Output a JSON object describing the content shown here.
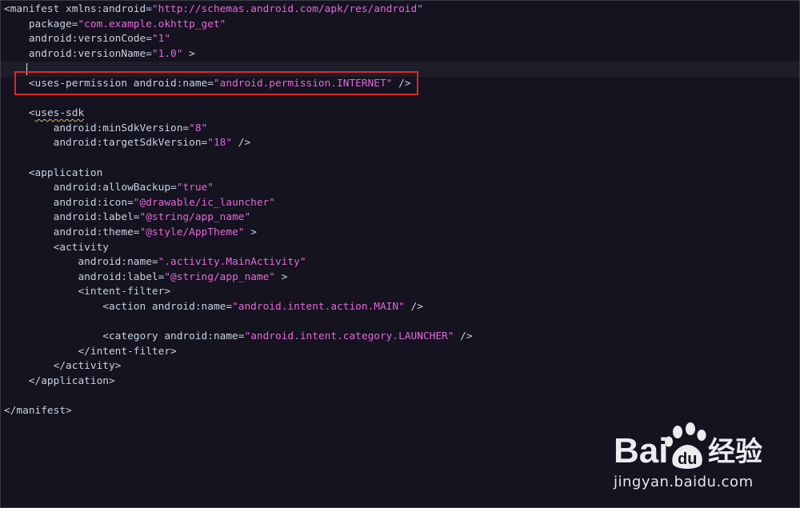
{
  "colors": {
    "background": "#14131f",
    "text": "#c8d2e0",
    "string": "#e468d8",
    "highlight_box": "#e0262a",
    "current_line": "#1e1e2b"
  },
  "editor": {
    "lines": [
      {
        "tokens": [
          {
            "t": "tag",
            "v": "<manifest xmlns:android="
          },
          {
            "t": "str",
            "v": "\"http://schemas.android.com/apk/res/android\""
          }
        ]
      },
      {
        "tokens": [
          {
            "t": "attr",
            "v": "    package="
          },
          {
            "t": "str",
            "v": "\"com.example.okhttp_get\""
          }
        ]
      },
      {
        "tokens": [
          {
            "t": "attr",
            "v": "    android:versionCode="
          },
          {
            "t": "str",
            "v": "\"1\""
          }
        ]
      },
      {
        "tokens": [
          {
            "t": "attr",
            "v": "    android:versionName="
          },
          {
            "t": "str",
            "v": "\"1.0\""
          },
          {
            "t": "punct",
            "v": " >"
          }
        ]
      },
      {
        "tokens": [],
        "current": true
      },
      {
        "tokens": [
          {
            "t": "tag",
            "v": "    <uses-permission android:name="
          },
          {
            "t": "str",
            "v": "\"android.permission.INTERNET\""
          },
          {
            "t": "punct",
            "v": " />"
          }
        ]
      },
      {
        "tokens": []
      },
      {
        "tokens": [
          {
            "t": "tag",
            "v": "    <"
          },
          {
            "t": "tag",
            "v": "uses-sdk",
            "squiggle": true
          }
        ]
      },
      {
        "tokens": [
          {
            "t": "attr",
            "v": "        android:minSdkVersion="
          },
          {
            "t": "str",
            "v": "\"8\""
          }
        ]
      },
      {
        "tokens": [
          {
            "t": "attr",
            "v": "        android:targetSdkVersion="
          },
          {
            "t": "str",
            "v": "\"18\""
          },
          {
            "t": "punct",
            "v": " />"
          }
        ]
      },
      {
        "tokens": []
      },
      {
        "tokens": [
          {
            "t": "tag",
            "v": "    <application"
          }
        ]
      },
      {
        "tokens": [
          {
            "t": "attr",
            "v": "        android:allowBackup="
          },
          {
            "t": "str",
            "v": "\"true\""
          }
        ]
      },
      {
        "tokens": [
          {
            "t": "attr",
            "v": "        android:icon="
          },
          {
            "t": "str",
            "v": "\"@drawable/ic_launcher\""
          }
        ]
      },
      {
        "tokens": [
          {
            "t": "attr",
            "v": "        android:label="
          },
          {
            "t": "str",
            "v": "\"@string/app_name\""
          }
        ]
      },
      {
        "tokens": [
          {
            "t": "attr",
            "v": "        android:theme="
          },
          {
            "t": "str",
            "v": "\"@style/AppTheme\""
          },
          {
            "t": "punct",
            "v": " >"
          }
        ]
      },
      {
        "tokens": [
          {
            "t": "tag",
            "v": "        <activity"
          }
        ]
      },
      {
        "tokens": [
          {
            "t": "attr",
            "v": "            android:name="
          },
          {
            "t": "str",
            "v": "\".activity.MainActivity\""
          }
        ]
      },
      {
        "tokens": [
          {
            "t": "attr",
            "v": "            android:label="
          },
          {
            "t": "str",
            "v": "\"@string/app_name\""
          },
          {
            "t": "punct",
            "v": " >"
          }
        ]
      },
      {
        "tokens": [
          {
            "t": "tag",
            "v": "            <intent-filter>"
          }
        ]
      },
      {
        "tokens": [
          {
            "t": "tag",
            "v": "                <action android:name="
          },
          {
            "t": "str",
            "v": "\"android.intent.action.MAIN\""
          },
          {
            "t": "punct",
            "v": " />"
          }
        ]
      },
      {
        "tokens": []
      },
      {
        "tokens": [
          {
            "t": "tag",
            "v": "                <category android:name="
          },
          {
            "t": "str",
            "v": "\"android.intent.category.LAUNCHER\""
          },
          {
            "t": "punct",
            "v": " />"
          }
        ]
      },
      {
        "tokens": [
          {
            "t": "tag",
            "v": "            </intent-filter>"
          }
        ]
      },
      {
        "tokens": [
          {
            "t": "tag",
            "v": "        </activity>"
          }
        ]
      },
      {
        "tokens": [
          {
            "t": "tag",
            "v": "    </application>"
          }
        ]
      },
      {
        "tokens": []
      },
      {
        "tokens": [
          {
            "t": "tag",
            "v": "</manifest>"
          }
        ]
      }
    ]
  },
  "watermark": {
    "brand": "Bai du 经验",
    "url": "jingyan.baidu.com"
  }
}
